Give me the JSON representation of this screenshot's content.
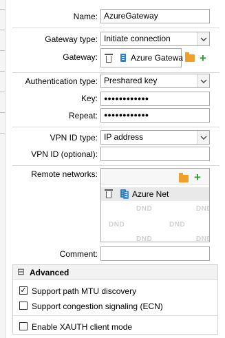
{
  "form": {
    "name_label": "Name:",
    "name_value": "AzureGateway",
    "gateway_type_label": "Gateway type:",
    "gateway_type_value": "Initiate connection",
    "gateway_label": "Gateway:",
    "gateway_value": "Azure Gatewa",
    "auth_type_label": "Authentication type:",
    "auth_type_value": "Preshared key",
    "key_label": "Key:",
    "key_value": "●●●●●●●●●●●●",
    "repeat_label": "Repeat:",
    "repeat_value": "●●●●●●●●●●●●",
    "vpn_id_type_label": "VPN ID type:",
    "vpn_id_type_value": "IP address",
    "vpn_id_optional_label": "VPN ID (optional):",
    "vpn_id_optional_value": "",
    "remote_networks_label": "Remote networks:",
    "remote_networks_items": [
      "Azure Net"
    ],
    "dnd_text": "DND",
    "comment_label": "Comment:",
    "comment_value": ""
  },
  "advanced": {
    "title": "Advanced",
    "collapse_glyph": "⊟",
    "options": [
      {
        "label": "Support path MTU discovery",
        "checked": true
      },
      {
        "label": "Support congestion signaling (ECN)",
        "checked": false
      },
      {
        "label": "Enable XAUTH client mode",
        "checked": false
      }
    ]
  },
  "glyphs": {
    "check": "✓",
    "arrow": "⌄",
    "plus": "+"
  },
  "colors": {
    "folder": "#f0a02a",
    "plus": "#2e9c2e",
    "server": "#2f7fc8"
  }
}
